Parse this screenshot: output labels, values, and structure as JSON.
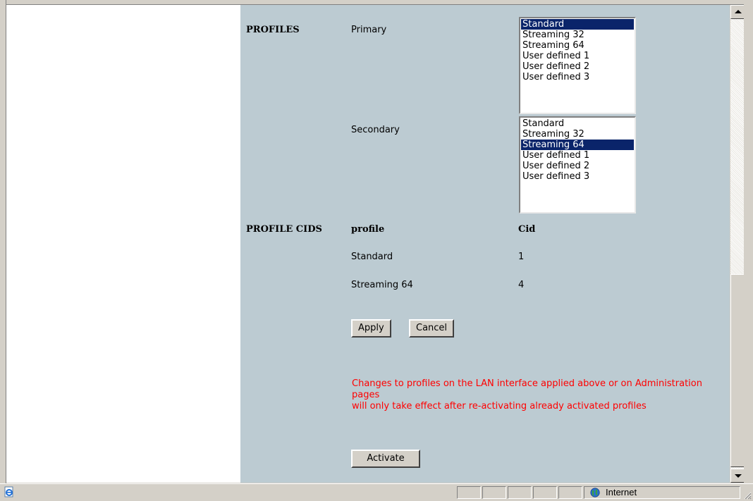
{
  "profiles": {
    "section_label": "PROFILES",
    "primary_label": "Primary",
    "secondary_label": "Secondary",
    "primary_options": [
      "Standard",
      "Streaming 32",
      "Streaming 64",
      "User defined 1",
      "User defined 2",
      "User defined 3"
    ],
    "primary_selected": "Standard",
    "secondary_options": [
      "Standard",
      "Streaming 32",
      "Streaming 64",
      "User defined 1",
      "User defined 2",
      "User defined 3"
    ],
    "secondary_selected": "Streaming 64"
  },
  "profile_cids": {
    "section_label": "PROFILE CIDS",
    "col_profile": "profile",
    "col_cid": "Cid",
    "rows": [
      {
        "profile": "Standard",
        "cid": "1"
      },
      {
        "profile": "Streaming 64",
        "cid": "4"
      }
    ]
  },
  "buttons": {
    "apply": "Apply",
    "cancel": "Cancel",
    "activate": "Activate"
  },
  "warning": {
    "line1": "Changes to profiles on the LAN interface applied above or on Administration pages",
    "line2": "will only take effect after re-activating already activated profiles"
  },
  "status_bar": {
    "zone": "Internet"
  },
  "colors": {
    "panel_bg": "#bccbd2",
    "selected_bg": "#0a246a",
    "warning_text": "#ff0000"
  },
  "icons": [
    "ie-page-icon",
    "globe-icon",
    "scroll-up-icon",
    "scroll-down-icon",
    "resize-grip-icon"
  ]
}
